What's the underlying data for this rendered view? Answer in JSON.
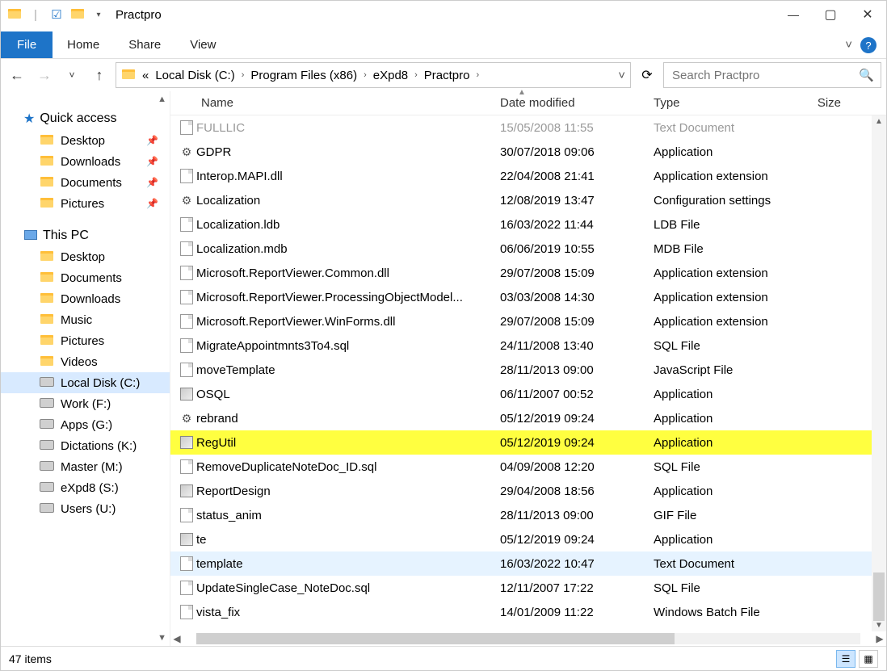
{
  "window": {
    "title": "Practpro"
  },
  "ribbon": {
    "file": "File",
    "tabs": [
      "Home",
      "Share",
      "View"
    ]
  },
  "nav": {
    "back": "←",
    "forward": "→",
    "recent": "˅",
    "up": "↑"
  },
  "breadcrumb": {
    "prefix": "«",
    "parts": [
      "Local Disk (C:)",
      "Program Files (x86)",
      "eXpd8",
      "Practpro"
    ]
  },
  "search": {
    "placeholder": "Search Practpro"
  },
  "sidebar": {
    "quick_access": {
      "label": "Quick access",
      "items": [
        {
          "label": "Desktop",
          "pinned": true
        },
        {
          "label": "Downloads",
          "pinned": true
        },
        {
          "label": "Documents",
          "pinned": true
        },
        {
          "label": "Pictures",
          "pinned": true
        }
      ]
    },
    "this_pc": {
      "label": "This PC",
      "items": [
        {
          "label": "Desktop"
        },
        {
          "label": "Documents"
        },
        {
          "label": "Downloads"
        },
        {
          "label": "Music"
        },
        {
          "label": "Pictures"
        },
        {
          "label": "Videos"
        },
        {
          "label": "Local Disk (C:)",
          "selected": true,
          "drive": true
        },
        {
          "label": "Work (F:)",
          "drive": true
        },
        {
          "label": "Apps (G:)",
          "drive": true
        },
        {
          "label": "Dictations (K:)",
          "drive": true
        },
        {
          "label": "Master (M:)",
          "drive": true
        },
        {
          "label": "eXpd8 (S:)",
          "drive": true
        },
        {
          "label": "Users (U:)",
          "drive": true
        }
      ]
    }
  },
  "columns": {
    "name": "Name",
    "date": "Date modified",
    "type": "Type",
    "size": "Size"
  },
  "files": [
    {
      "name": "FULLLIC",
      "date": "15/05/2008 11:55",
      "type": "Text Document",
      "icon": "file",
      "cut": true
    },
    {
      "name": "GDPR",
      "date": "30/07/2018 09:06",
      "type": "Application",
      "icon": "gear"
    },
    {
      "name": "Interop.MAPI.dll",
      "date": "22/04/2008 21:41",
      "type": "Application extension",
      "icon": "file"
    },
    {
      "name": "Localization",
      "date": "12/08/2019 13:47",
      "type": "Configuration settings",
      "icon": "gear"
    },
    {
      "name": "Localization.ldb",
      "date": "16/03/2022 11:44",
      "type": "LDB File",
      "icon": "file"
    },
    {
      "name": "Localization.mdb",
      "date": "06/06/2019 10:55",
      "type": "MDB File",
      "icon": "file"
    },
    {
      "name": "Microsoft.ReportViewer.Common.dll",
      "date": "29/07/2008 15:09",
      "type": "Application extension",
      "icon": "file"
    },
    {
      "name": "Microsoft.ReportViewer.ProcessingObjectModel...",
      "date": "03/03/2008 14:30",
      "type": "Application extension",
      "icon": "file"
    },
    {
      "name": "Microsoft.ReportViewer.WinForms.dll",
      "date": "29/07/2008 15:09",
      "type": "Application extension",
      "icon": "file"
    },
    {
      "name": "MigrateAppointmnts3To4.sql",
      "date": "24/11/2008 13:40",
      "type": "SQL File",
      "icon": "file"
    },
    {
      "name": "moveTemplate",
      "date": "28/11/2013 09:00",
      "type": "JavaScript File",
      "icon": "file"
    },
    {
      "name": "OSQL",
      "date": "06/11/2007 00:52",
      "type": "Application",
      "icon": "app"
    },
    {
      "name": "rebrand",
      "date": "05/12/2019 09:24",
      "type": "Application",
      "icon": "gear"
    },
    {
      "name": "RegUtil",
      "date": "05/12/2019 09:24",
      "type": "Application",
      "icon": "app",
      "highlight": true
    },
    {
      "name": "RemoveDuplicateNoteDoc_ID.sql",
      "date": "04/09/2008 12:20",
      "type": "SQL File",
      "icon": "file"
    },
    {
      "name": "ReportDesign",
      "date": "29/04/2008 18:56",
      "type": "Application",
      "icon": "app"
    },
    {
      "name": "status_anim",
      "date": "28/11/2013 09:00",
      "type": "GIF File",
      "icon": "file"
    },
    {
      "name": "te",
      "date": "05/12/2019 09:24",
      "type": "Application",
      "icon": "app"
    },
    {
      "name": "template",
      "date": "16/03/2022 10:47",
      "type": "Text Document",
      "icon": "file",
      "sel": true
    },
    {
      "name": "UpdateSingleCase_NoteDoc.sql",
      "date": "12/11/2007 17:22",
      "type": "SQL File",
      "icon": "file"
    },
    {
      "name": "vista_fix",
      "date": "14/01/2009 11:22",
      "type": "Windows Batch File",
      "icon": "file"
    }
  ],
  "status": {
    "text": "47 items"
  }
}
